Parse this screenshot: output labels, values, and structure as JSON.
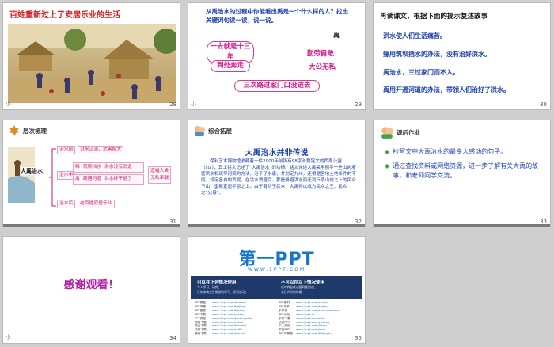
{
  "slides": [
    {
      "num": "28",
      "title": "百姓重新过上了安居乐业的生活",
      "mark": "小"
    },
    {
      "num": "29",
      "question": "从禹治水的过程中你能看出禹是一个什么样的人？找出关键词句读一读，说一说。",
      "keyword": "禹",
      "phrases": [
        "一去就是十三年",
        "到处奔走",
        "三次路过家门口没进去"
      ],
      "traits": [
        "勤劳勇敢",
        "大公无私"
      ],
      "mark": "小"
    },
    {
      "num": "30",
      "heading": "再读课文，根据下面的提示复述故事",
      "lines": [
        "洪水使人们生活痛苦。",
        "鲧用筑坝挡水的办法，没有治好洪水。",
        "禹治水，三过家门而不入。",
        "禹用开通河道的办法，带领人们治好了洪水。"
      ]
    },
    {
      "num": "31",
      "tag": "层次梳理",
      "center": "大禹治水",
      "stages": [
        "治水前",
        "治水中",
        "治水后"
      ],
      "before": "洪水泛滥，危害极大",
      "middle": [
        [
          "鲧",
          "筑坝挡水",
          "洪水没有消退"
        ],
        [
          "禹",
          "疏通河道",
          "洪水终于退了"
        ]
      ],
      "after": "老百姓安居乐业",
      "traits": [
        "造福人类",
        "无私奉献"
      ]
    },
    {
      "num": "32",
      "tag": "综合拓展",
      "title": "大禹治水并非传说",
      "body": "保利艺术博物馆收藏着一件2900年前铸有98字长篇铭文的西周公盨（suì），其上铭文记述了“大禹治水”的功绩。铭文详述大禹采用削平一些山岗堵塞洪水和疏导河流的方法，治平了水患，并划定九州，还根据各地土地条件的不同，规定各自的贡赋，在洪水消退后，那些躲避洪水而迁到丘陵山岗之上的民众下山，重新定居平原之上。由于有功于民众，大禹得以成为民众之王、民众之“父母”。"
    },
    {
      "num": "33",
      "tag": "课后作业",
      "items": [
        "抄写文中大禹治水的最令人感动的句子。",
        "通过查找资料或网络资源，进一步了解有关大禹的故事，和老师同学交流。"
      ]
    },
    {
      "num": "34",
      "thanks": "感谢观看！",
      "mark": "小"
    },
    {
      "num": "35",
      "logo_main": "第一PPT",
      "logo_url": "WWW.1PPT.COM",
      "col1_head": "可以在下列情况使用",
      "col2_head": "不可以在以下情况使用",
      "col1_sub": [
        "个人学习、研究；",
        "任何非商业性用途的学习、研究活动；"
      ],
      "col2_sub": [
        "任何商业性或营利性用途；",
        "未经许可的转载"
      ],
      "links_left": [
        "PPT模板",
        "PPT背景",
        "PPT图表",
        "PPT下载",
        "PPT教程",
        "资料下载",
        "范文下载",
        "试卷下载",
        "教案下载"
      ],
      "links_mid": [
        "www.1ppt.com/moban/",
        "www.1ppt.com/beijing/",
        "www.1ppt.com/tubiao/",
        "www.1ppt.com/xiazai/",
        "www.1ppt.com/powerpoint/",
        "www.1ppt.com/ziliao/",
        "www.1ppt.com/fanwen/",
        "www.1ppt.com/shiti/",
        "www.1ppt.com/jiaoan/"
      ],
      "links_right_label": [
        "PPT素材",
        "PPT课件",
        "手抄报",
        "PPT论坛",
        "字体下载",
        "优秀PPT",
        "个人简历",
        "节日PPT",
        "PPT背景图"
      ],
      "links_right": [
        "www.1ppt.com/sucai/",
        "www.1ppt.com/kejian/",
        "www.1ppt.com/shouchaobao/",
        "www.1ppt.cn",
        "www.1ppt.com/ziti/",
        "www.1ppt.com/youxiu/",
        "www.1ppt.com/jianli/",
        "www.1ppt.com/jieri/",
        "www.1ppt.com/beijingtu/"
      ]
    }
  ]
}
